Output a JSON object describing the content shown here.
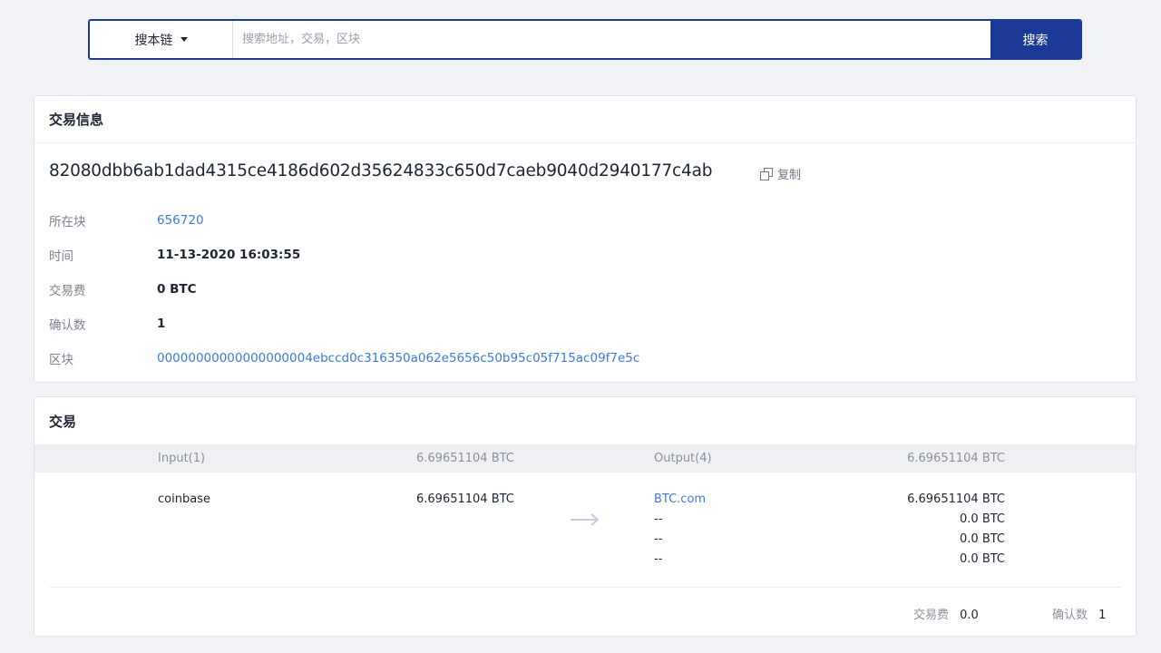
{
  "search": {
    "chain_label": "搜本链",
    "placeholder": "搜索地址，交易，区块",
    "button_label": "搜索"
  },
  "tx_info": {
    "title": "交易信息",
    "hash": "82080dbb6ab1dad4315ce4186d602d35624833c650d7caeb9040d2940177c4ab",
    "copy_label": "复制",
    "rows": [
      {
        "label": "所在块",
        "value": "656720"
      },
      {
        "label": "时间",
        "value": "11-13-2020 16:03:55"
      },
      {
        "label": "交易费",
        "value": "0 BTC"
      },
      {
        "label": "确认数",
        "value": "1"
      },
      {
        "label": "区块",
        "value": "00000000000000000004ebccd0c316350a062e5656c50b95c05f715ac09f7e5c"
      }
    ]
  },
  "transaction": {
    "title": "交易",
    "header": {
      "input_label": "Input(1)",
      "input_total": "6.69651104 BTC",
      "output_label": "Output(4)",
      "output_total": "6.69651104 BTC"
    },
    "inputs": [
      {
        "address": "coinbase",
        "amount": "6.69651104 BTC"
      }
    ],
    "outputs": [
      {
        "address": "BTC.com",
        "amount": "6.69651104 BTC"
      },
      {
        "address": "--",
        "amount": "0.0 BTC"
      },
      {
        "address": "--",
        "amount": "0.0 BTC"
      },
      {
        "address": "--",
        "amount": "0.0 BTC"
      }
    ],
    "footer": {
      "fee_label": "交易费",
      "fee_value": "0.0",
      "confirmations_label": "确认数",
      "confirmations_value": "1"
    }
  },
  "colors": {
    "brand": "#1b3a98",
    "link": "#3d7bd9"
  }
}
